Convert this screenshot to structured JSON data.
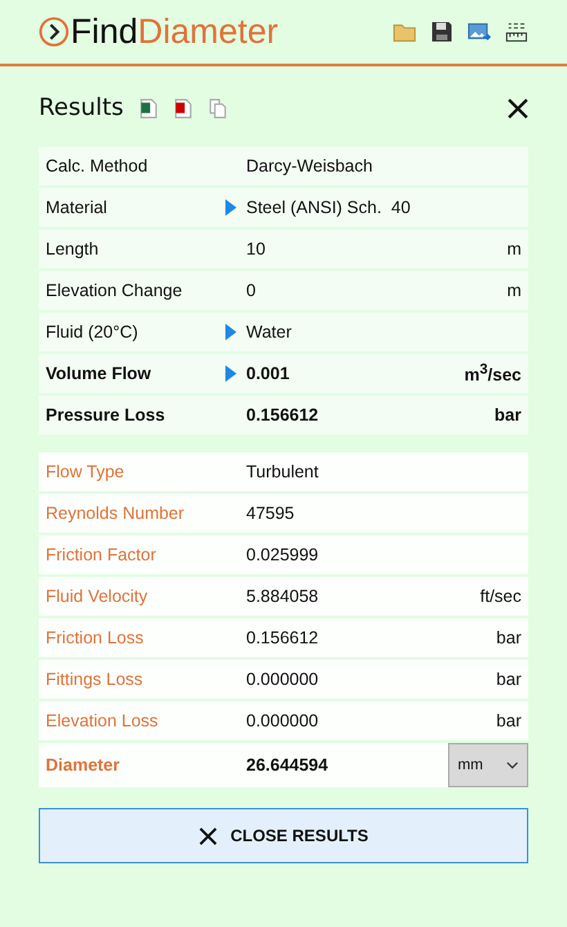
{
  "app_title": [
    "Find",
    "Diameter"
  ],
  "panel": {
    "title": "Results"
  },
  "inputs": [
    {
      "label": "Calc. Method",
      "value": "Darcy-Weisbach",
      "expandable": false,
      "bold": false
    },
    {
      "label": "Material",
      "value": "Steel (ANSI) Sch.  40",
      "expandable": true,
      "bold": false
    },
    {
      "label": "Length",
      "value": "10",
      "unit": "m",
      "expandable": false,
      "bold": false
    },
    {
      "label": "Elevation Change",
      "value": "0",
      "unit": "m",
      "expandable": false,
      "bold": false
    },
    {
      "label": "Fluid (20°C)",
      "value": "Water",
      "expandable": true,
      "bold": false
    },
    {
      "label": "Volume Flow",
      "value": "0.001",
      "unit": "m$^{3}$/sec",
      "expandable": true,
      "bold": true
    },
    {
      "label": "Pressure Loss",
      "value": "0.156612",
      "unit": "bar",
      "expandable": false,
      "bold": true
    }
  ],
  "results": [
    {
      "kind": "text",
      "label": "Flow Type",
      "value": "Turbulent"
    },
    {
      "kind": "text",
      "label": "Reynolds Number",
      "value": "47595"
    },
    {
      "kind": "text",
      "label": "Friction Factor",
      "value": "0.025999"
    },
    {
      "kind": "text",
      "label": "Fluid Velocity",
      "value": "5.884058",
      "unit": "ft/sec"
    },
    {
      "kind": "text",
      "label": "Friction Loss",
      "value": "0.156612",
      "unit": "bar"
    },
    {
      "kind": "text",
      "label": "Fittings Loss",
      "value": "0.000000",
      "unit": "bar"
    },
    {
      "kind": "text",
      "label": "Elevation Loss",
      "value": "0.000000",
      "unit": "bar"
    },
    {
      "kind": "select",
      "label": "Diameter",
      "value": "26.644594",
      "unit": "mm"
    }
  ],
  "close_button": "CLOSE RESULTS"
}
